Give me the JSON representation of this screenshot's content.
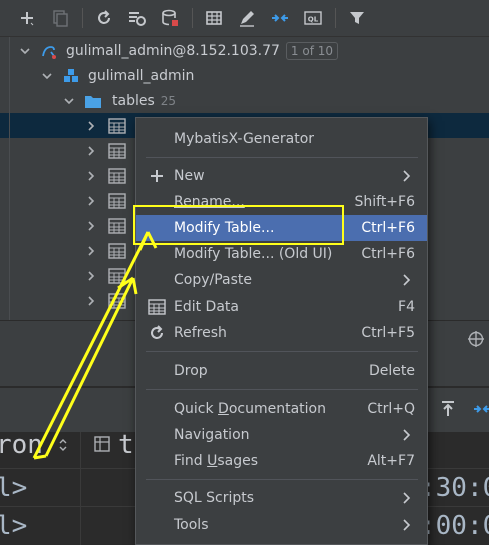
{
  "toolbar": {
    "icons": [
      "add-icon",
      "duplicate-icon",
      "refresh-icon",
      "schema-settings-icon",
      "database-tools-icon",
      "table-view-icon",
      "edit-icon",
      "jump-to-source-icon",
      "ql-console-icon",
      "filter-icon"
    ]
  },
  "tree": {
    "connection": {
      "label": "gulimall_admin@8.152.103.77",
      "badge": "1 of 10"
    },
    "schema": {
      "label": "gulimall_admin"
    },
    "folder": {
      "label": "tables",
      "count": "25"
    },
    "table_rows": 8
  },
  "grid": {
    "header_left": "ron",
    "header_right": "t",
    "rows": [
      {
        "left": "l>",
        "right": ":30:0"
      },
      {
        "left": "l>",
        "right": ":00:0"
      }
    ]
  },
  "menu": {
    "items": [
      {
        "label": "MybatisX-Generator",
        "shortcut": ""
      },
      {
        "label": "New",
        "shortcut": "",
        "icon": "plus-icon",
        "submenu": true
      },
      {
        "label": "Rename...",
        "shortcut": "Shift+F6"
      },
      {
        "label": "Modify Table...",
        "shortcut": "Ctrl+F6",
        "highlighted": true
      },
      {
        "label": "Modify Table... (Old UI)",
        "shortcut": "Ctrl+F6"
      },
      {
        "label": "Copy/Paste",
        "shortcut": "",
        "submenu": true
      },
      {
        "label": "Edit Data",
        "shortcut": "F4",
        "icon": "table-icon"
      },
      {
        "label": "Refresh",
        "shortcut": "Ctrl+F5",
        "icon": "refresh-icon"
      },
      {
        "label": "Drop",
        "shortcut": "Delete"
      },
      {
        "label_pre": "Quick ",
        "label_ul": "D",
        "label_post": "ocumentation",
        "shortcut": "Ctrl+Q"
      },
      {
        "label": "Navigation",
        "shortcut": "",
        "submenu": true
      },
      {
        "label_pre": "Find ",
        "label_ul": "U",
        "label_post": "sages",
        "shortcut": "Alt+F7"
      },
      {
        "label": "SQL Scripts",
        "shortcut": "",
        "submenu": true
      },
      {
        "label": "Tools",
        "shortcut": "",
        "submenu": true
      }
    ]
  },
  "colors": {
    "menu_highlight": "#4b6eaf",
    "annotation": "#ffff1a",
    "selected_row": "#0d293e"
  }
}
